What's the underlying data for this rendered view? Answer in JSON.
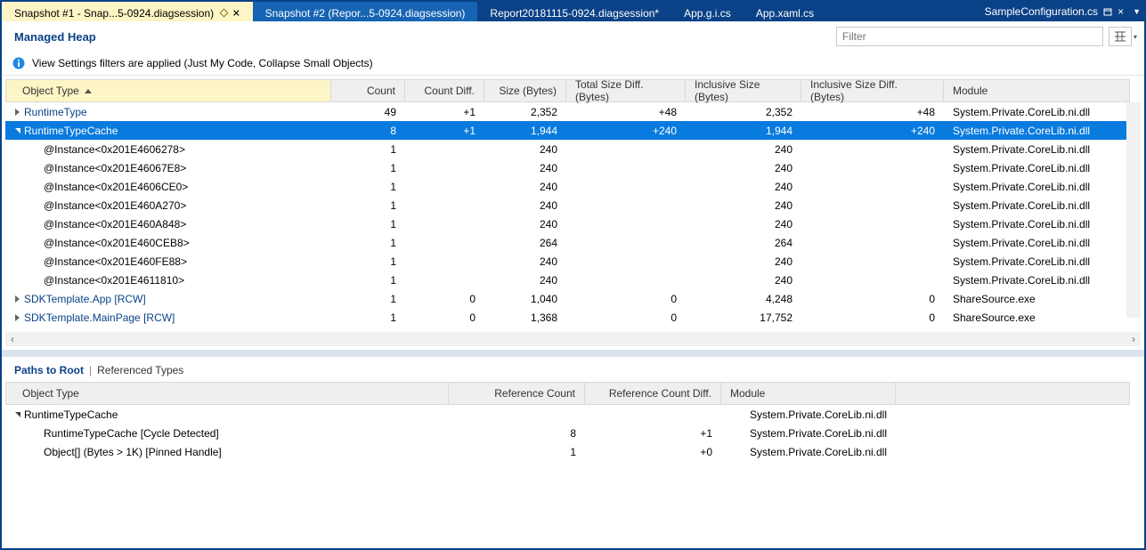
{
  "tabs": [
    {
      "label": "Snapshot #1 - Snap...5-0924.diagsession)",
      "active": true,
      "pinned": true,
      "close": true
    },
    {
      "label": "Snapshot #2 (Repor...5-0924.diagsession)",
      "inner": true
    },
    {
      "label": "Report20181115-0924.diagsession*"
    },
    {
      "label": "App.g.i.cs"
    },
    {
      "label": "App.xaml.cs"
    }
  ],
  "rightFile": "SampleConfiguration.cs",
  "heapTitle": "Managed Heap",
  "filterPlaceholder": "Filter",
  "infoText": "View Settings filters are applied (Just My Code, Collapse Small Objects)",
  "topCols": [
    "Object Type",
    "Count",
    "Count Diff.",
    "Size (Bytes)",
    "Total Size Diff. (Bytes)",
    "Inclusive Size (Bytes)",
    "Inclusive Size Diff. (Bytes)",
    "Module"
  ],
  "topRows": [
    {
      "indent": 1,
      "exp": "collapsed",
      "link": true,
      "cells": [
        "RuntimeType",
        "49",
        "+1",
        "2,352",
        "+48",
        "2,352",
        "+48",
        "System.Private.CoreLib.ni.dll"
      ]
    },
    {
      "indent": 1,
      "exp": "expanded",
      "link": true,
      "sel": true,
      "cells": [
        "RuntimeTypeCache",
        "8",
        "+1",
        "1,944",
        "+240",
        "1,944",
        "+240",
        "System.Private.CoreLib.ni.dll"
      ]
    },
    {
      "indent": 2,
      "exp": "none",
      "cells": [
        "@Instance<0x201E4606278>",
        "1",
        "",
        "240",
        "",
        "240",
        "",
        "System.Private.CoreLib.ni.dll"
      ]
    },
    {
      "indent": 2,
      "exp": "none",
      "cells": [
        "@Instance<0x201E46067E8>",
        "1",
        "",
        "240",
        "",
        "240",
        "",
        "System.Private.CoreLib.ni.dll"
      ]
    },
    {
      "indent": 2,
      "exp": "none",
      "cells": [
        "@Instance<0x201E4606CE0>",
        "1",
        "",
        "240",
        "",
        "240",
        "",
        "System.Private.CoreLib.ni.dll"
      ]
    },
    {
      "indent": 2,
      "exp": "none",
      "cells": [
        "@Instance<0x201E460A270>",
        "1",
        "",
        "240",
        "",
        "240",
        "",
        "System.Private.CoreLib.ni.dll"
      ]
    },
    {
      "indent": 2,
      "exp": "none",
      "cells": [
        "@Instance<0x201E460A848>",
        "1",
        "",
        "240",
        "",
        "240",
        "",
        "System.Private.CoreLib.ni.dll"
      ]
    },
    {
      "indent": 2,
      "exp": "none",
      "cells": [
        "@Instance<0x201E460CEB8>",
        "1",
        "",
        "264",
        "",
        "264",
        "",
        "System.Private.CoreLib.ni.dll"
      ]
    },
    {
      "indent": 2,
      "exp": "none",
      "cells": [
        "@Instance<0x201E460FE88>",
        "1",
        "",
        "240",
        "",
        "240",
        "",
        "System.Private.CoreLib.ni.dll"
      ]
    },
    {
      "indent": 2,
      "exp": "none",
      "cells": [
        "@Instance<0x201E4611810>",
        "1",
        "",
        "240",
        "",
        "240",
        "",
        "System.Private.CoreLib.ni.dll"
      ]
    },
    {
      "indent": 1,
      "exp": "collapsed",
      "link": true,
      "cells": [
        "SDKTemplate.App [RCW]",
        "1",
        "0",
        "1,040",
        "0",
        "4,248",
        "0",
        "ShareSource.exe"
      ]
    },
    {
      "indent": 1,
      "exp": "collapsed",
      "link": true,
      "cells": [
        "SDKTemplate.MainPage [RCW]",
        "1",
        "0",
        "1,368",
        "0",
        "17,752",
        "0",
        "ShareSource.exe"
      ]
    }
  ],
  "bottomTabs": {
    "a": "Paths to Root",
    "sep": "|",
    "b": "Referenced Types"
  },
  "botCols": [
    "Object Type",
    "Reference Count",
    "Reference Count Diff.",
    "Module",
    ""
  ],
  "botRows": [
    {
      "indent": 1,
      "exp": "expanded",
      "cells": [
        "RuntimeTypeCache",
        "",
        "",
        "System.Private.CoreLib.ni.dll",
        ""
      ]
    },
    {
      "indent": 2,
      "exp": "none",
      "cells": [
        "RuntimeTypeCache [Cycle Detected]",
        "8",
        "+1",
        "System.Private.CoreLib.ni.dll",
        ""
      ]
    },
    {
      "indent": 2,
      "exp": "none",
      "cells": [
        "Object[] (Bytes > 1K) [Pinned Handle]",
        "1",
        "+0",
        "System.Private.CoreLib.ni.dll",
        ""
      ]
    }
  ]
}
